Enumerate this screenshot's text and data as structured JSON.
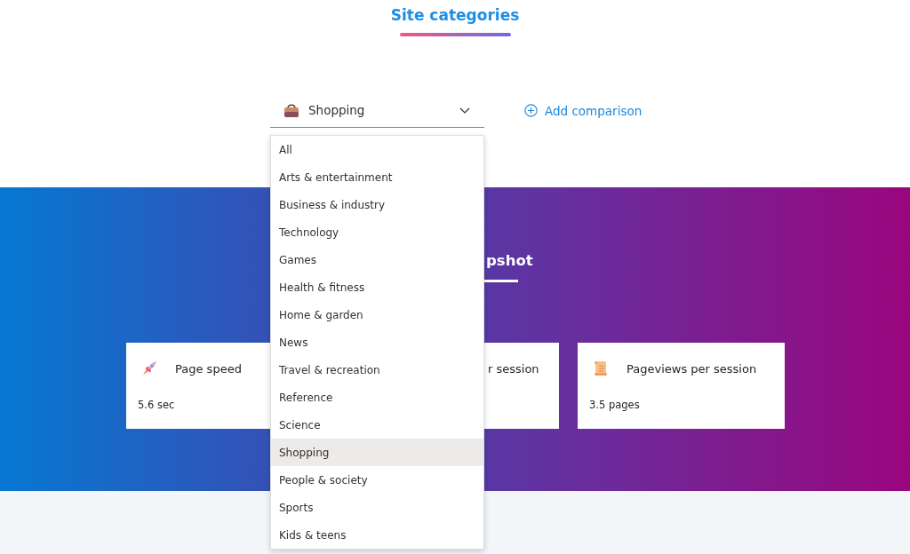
{
  "header": {
    "title": "Site categories"
  },
  "category_select": {
    "value": "Shopping",
    "expanded": true
  },
  "add_comparison": {
    "label": "Add comparison"
  },
  "category_menu": {
    "items": [
      {
        "label": "All",
        "selected": false
      },
      {
        "label": "Arts & entertainment",
        "selected": false
      },
      {
        "label": "Business & industry",
        "selected": false
      },
      {
        "label": "Technology",
        "selected": false
      },
      {
        "label": "Games",
        "selected": false
      },
      {
        "label": "Health & fitness",
        "selected": false
      },
      {
        "label": "Home & garden",
        "selected": false
      },
      {
        "label": "News",
        "selected": false
      },
      {
        "label": "Travel & recreation",
        "selected": false
      },
      {
        "label": "Reference",
        "selected": false
      },
      {
        "label": "Science",
        "selected": false
      },
      {
        "label": "Shopping",
        "selected": true
      },
      {
        "label": "People & society",
        "selected": false
      },
      {
        "label": "Sports",
        "selected": false
      },
      {
        "label": "Kids & teens",
        "selected": false
      }
    ]
  },
  "snapshot": {
    "title": "pshot",
    "cards": [
      {
        "kind": "rocket",
        "title": "Page speed",
        "value": "5.6 sec"
      },
      {
        "kind": "covered",
        "title": "r session"
      },
      {
        "kind": "scroll",
        "title": "Pageviews per session",
        "value": "3.5 pages"
      }
    ]
  }
}
